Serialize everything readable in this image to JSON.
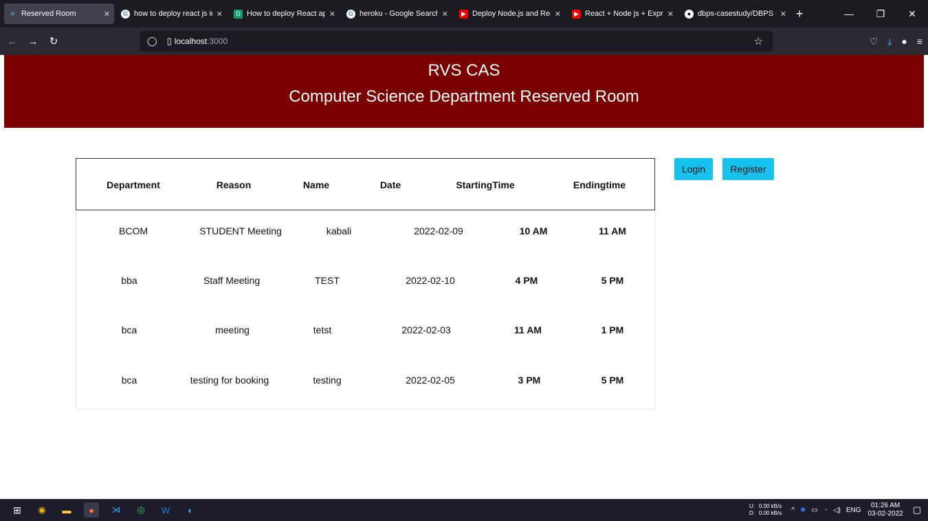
{
  "browser": {
    "tabs": [
      {
        "title": "Reserved Room",
        "icon": "react-icon",
        "icon_color": "#61dafb",
        "active": true
      },
      {
        "title": "how to deploy react js in",
        "icon": "google-icon",
        "icon_color": "#4285f4"
      },
      {
        "title": "How to deploy React ap",
        "icon": "dev-icon",
        "icon_color": "#0aa36b"
      },
      {
        "title": "heroku - Google Search",
        "icon": "google-icon",
        "icon_color": "#4285f4"
      },
      {
        "title": "Deploy Node.js and Rea",
        "icon": "youtube-icon",
        "icon_color": "#ff0000"
      },
      {
        "title": "React + Node js + Expre",
        "icon": "youtube-icon",
        "icon_color": "#ff0000"
      },
      {
        "title": "dbps-casestudy/DBPS (D",
        "icon": "github-icon",
        "icon_color": "#ffffff"
      }
    ],
    "url_host": "localhost",
    "url_port": ":3000"
  },
  "header": {
    "line1": "RVS CAS",
    "line2": "Computer Science Department Reserved Room"
  },
  "table": {
    "columns": [
      "Department",
      "Reason",
      "Name",
      "Date",
      "StartingTime",
      "Endingtime"
    ],
    "rows": [
      [
        "BCOM",
        "STUDENT Meeting",
        "kabali",
        "2022-02-09",
        "10 AM",
        "11 AM"
      ],
      [
        "bba",
        "Staff Meeting",
        "TEST",
        "2022-02-10",
        "4 PM",
        "5 PM"
      ],
      [
        "bca",
        "meeting",
        "tetst",
        "2022-02-03",
        "11 AM",
        "1 PM"
      ],
      [
        "bca",
        "testing for booking",
        "testing",
        "2022-02-05",
        "3 PM",
        "5 PM"
      ]
    ]
  },
  "actions": {
    "login_label": "Login",
    "register_label": "Register",
    "button_color": "#17c3ec"
  },
  "taskbar": {
    "net_up": "0.00 kB/s",
    "net_down": "0.00 kB/s",
    "net_up_label": "U:",
    "net_down_label": "D:",
    "language": "ENG",
    "time": "01:26 AM",
    "date": "03-02-2022"
  },
  "colors": {
    "header_bg": "#7a0000"
  }
}
